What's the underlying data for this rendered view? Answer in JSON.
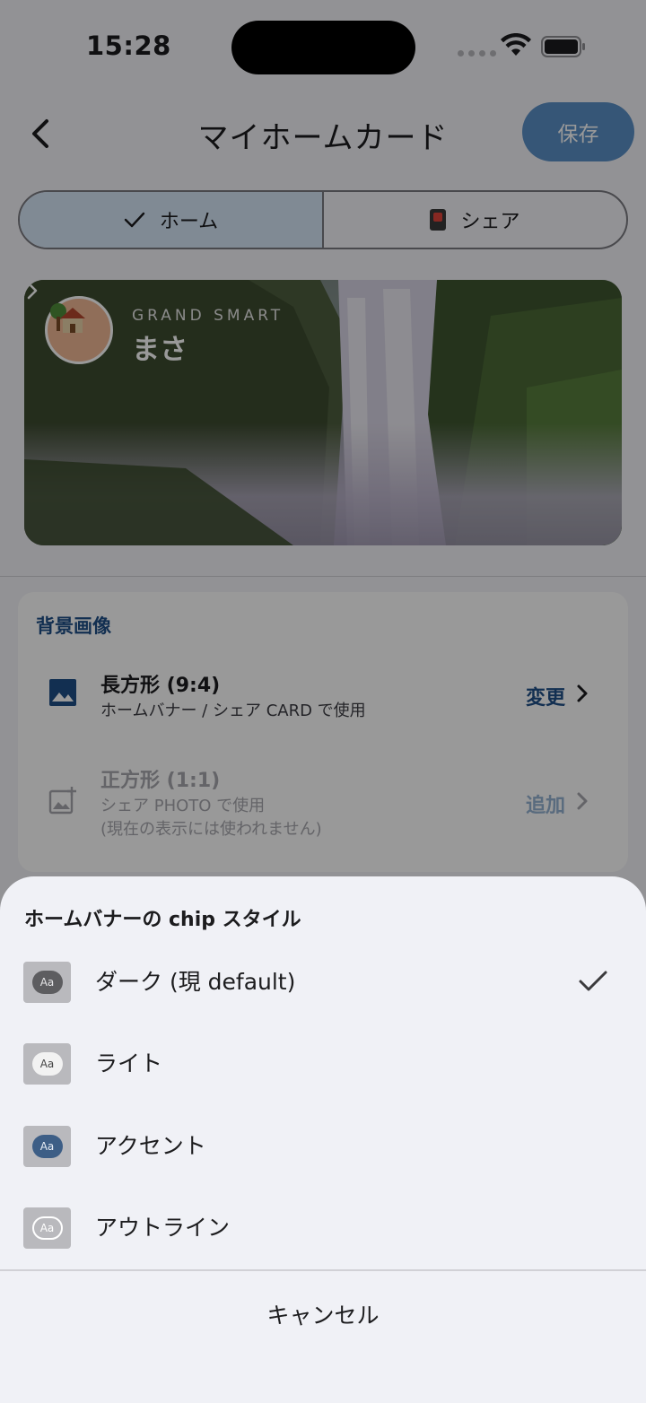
{
  "status_bar": {
    "time": "15:28"
  },
  "header": {
    "title": "マイホームカード",
    "save_label": "保存"
  },
  "segment": {
    "tabs": [
      {
        "label": "ホーム",
        "icon": "checkmark-icon",
        "selected": true
      },
      {
        "label": "シェア",
        "icon": "card-icon",
        "selected": false
      }
    ]
  },
  "banner": {
    "brand": "GRAND SMART",
    "owner": "まさ"
  },
  "background_card": {
    "title": "背景画像",
    "rows": [
      {
        "title": "長方形 (9:4)",
        "subtitle": "ホームバナー / シェア CARD で使用",
        "action": "変更",
        "enabled": true
      },
      {
        "title": "正方形 (1:1)",
        "subtitle_line1": "シェア PHOTO で使用",
        "subtitle_line2": "(現在の表示には使われません)",
        "action": "追加",
        "enabled": false
      }
    ]
  },
  "sheet": {
    "title": "ホームバナーの chip スタイル",
    "chip_text": "Aa",
    "options": [
      {
        "label": "ダーク (現 default)",
        "style": "dark",
        "selected": true
      },
      {
        "label": "ライト",
        "style": "light",
        "selected": false
      },
      {
        "label": "アクセント",
        "style": "accent",
        "selected": false
      },
      {
        "label": "アウトライン",
        "style": "outline",
        "selected": false
      }
    ],
    "cancel_label": "キャンセル"
  },
  "colors": {
    "accent": "#1f4f88",
    "save_button": "#5a8fc6",
    "segment_active": "#d6e6f7"
  }
}
